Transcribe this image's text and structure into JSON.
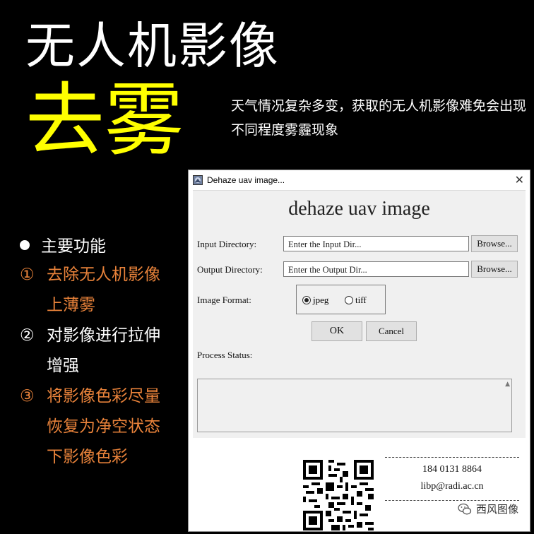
{
  "poster": {
    "title": "无人机影像",
    "subtitle": "去雾",
    "description": "天气情况复杂多变，获取的无人机影像难免会出现不同程度雾霾现象",
    "features_heading": "主要功能",
    "features": [
      {
        "num": "①",
        "text": "去除无人机影像上薄雾",
        "color": "#e8823a"
      },
      {
        "num": "②",
        "text": "对影像进行拉伸增强",
        "color": "#ffffff"
      },
      {
        "num": "③",
        "text": "将影像色彩尽量恢复为净空状态下影像色彩",
        "color": "#e8823a"
      }
    ]
  },
  "dialog": {
    "window_title": "Dehaze uav image...",
    "heading": "dehaze uav image",
    "input_label": "Input  Directory:",
    "input_value": "Enter the Input Dir...",
    "output_label": "Output  Directory:",
    "output_value": "Enter the Output Dir...",
    "browse_label": "Browse...",
    "format_label": "Image Format:",
    "format_options": [
      "jpeg",
      "tiff"
    ],
    "format_selected": "jpeg",
    "ok_label": "OK",
    "cancel_label": "Cancel",
    "status_label": "Process Status:",
    "status_text": ""
  },
  "footer": {
    "phone": "184 0131 8864",
    "email": "libp@radi.ac.cn"
  },
  "watermark": "西风图像",
  "icons": {
    "app": "app-icon",
    "close": "close-icon",
    "scroll": "scroll-up-icon",
    "qr": "qr-code",
    "wechat": "wechat-icon"
  }
}
